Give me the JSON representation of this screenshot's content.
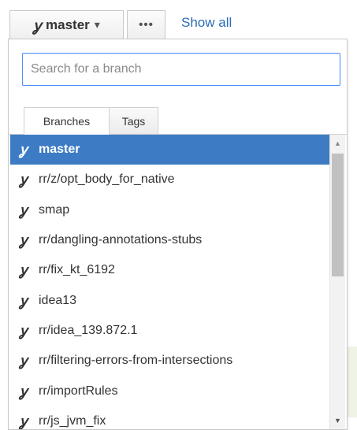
{
  "toolbar": {
    "branch_icon": "branch-icon",
    "current_branch": "master",
    "caret": "▾",
    "more_label": "•••",
    "show_all": "Show all"
  },
  "search": {
    "placeholder": "Search for a branch",
    "value": ""
  },
  "tabs": [
    {
      "label": "Branches",
      "active": true
    },
    {
      "label": "Tags",
      "active": false
    }
  ],
  "branches": [
    {
      "name": "master",
      "selected": true
    },
    {
      "name": "rr/z/opt_body_for_native",
      "selected": false
    },
    {
      "name": "smap",
      "selected": false
    },
    {
      "name": "rr/dangling-annotations-stubs",
      "selected": false
    },
    {
      "name": "rr/fix_kt_6192",
      "selected": false
    },
    {
      "name": "idea13",
      "selected": false
    },
    {
      "name": "rr/idea_139.872.1",
      "selected": false
    },
    {
      "name": "rr/filtering-errors-from-intersections",
      "selected": false
    },
    {
      "name": "rr/importRules",
      "selected": false
    },
    {
      "name": "rr/js_jvm_fix",
      "selected": false
    }
  ],
  "scrollbar": {
    "up_icon": "scroll-up-arrow-icon",
    "down_icon": "scroll-down-arrow-icon"
  },
  "colors": {
    "selected_row": "#3d7cc4",
    "link": "#2a6db6",
    "focus_border": "#4d90fe"
  }
}
